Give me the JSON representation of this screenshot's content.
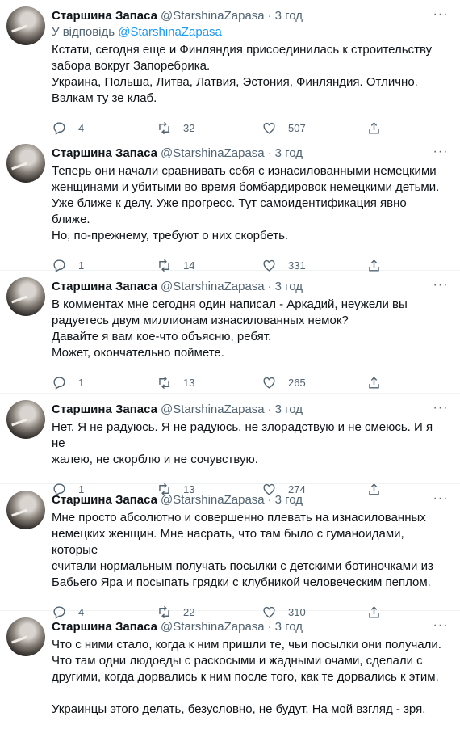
{
  "tweets": [
    {
      "name": "Старшина Запаса",
      "handle": "@StarshinaZapasa",
      "time": "3 год",
      "reply_prefix": "У відповідь",
      "reply_handle": "@StarshinaZapasa",
      "text": "Кстати, сегодня еще и Финляндия присоединилась к строительству\nзабора вокруг Запоребрика.\nУкраина, Польша, Литва, Латвия, Эстония, Финляндия. Отлично.\nВэлкам ту зе клаб.",
      "replies": "4",
      "retweets": "32",
      "likes": "507"
    },
    {
      "name": "Старшина Запаса",
      "handle": "@StarshinaZapasa",
      "time": "3 год",
      "text": "Теперь они начали сравнивать себя с изнасилованными немецкими\nженщинами и убитыми во время бомбардировок немецкими детьми.\nУже ближе к делу. Уже прогресс. Тут самоидентификация явно ближе.\nНо, по-прежнему, требуют о них скорбеть.",
      "replies": "1",
      "retweets": "14",
      "likes": "331"
    },
    {
      "name": "Старшина Запаса",
      "handle": "@StarshinaZapasa",
      "time": "3 год",
      "text": "В комментах мне сегодня один написал - Аркадий, неужели вы\nрадуетесь двум миллионам изнасилованных немок?\nДавайте я вам кое-что объясню, ребят.\nМожет, окончательно поймете.",
      "replies": "1",
      "retweets": "13",
      "likes": "265"
    },
    {
      "name": "Старшина Запаса",
      "handle": "@StarshinaZapasa",
      "time": "3 год",
      "text": "Нет. Я не радуюсь. Я не радуюсь, не злорадствую и не смеюсь. И я не\nжалею, не скорблю и не сочувствую.",
      "replies": "1",
      "retweets": "13",
      "likes": "274"
    },
    {
      "name": "Старшина Запаса",
      "handle": "@StarshinaZapasa",
      "time": "3 год",
      "text": "Мне просто абсолютно и совершенно плевать на изнасилованных\nнемецких женщин. Мне насрать, что там было с гуманоидами, которые\nсчитали нормальным получать посылки с детскими ботиночками из\nБабьего Яра и посыпать грядки с клубникой человеческим пеплом.",
      "replies": "4",
      "retweets": "22",
      "likes": "310"
    },
    {
      "name": "Старшина Запаса",
      "handle": "@StarshinaZapasa",
      "time": "3 год",
      "text": "Что с ними стало, когда к ним пришли те, чьи посылки они получали.\nЧто там одни людоеды с раскосыми и жадными очами, сделали с\nдругими, когда дорвались к ним после того, как те дорвались к этим.\n\nУкраинцы этого делать, безусловно, не будут. На мой взгляд - зря."
    }
  ],
  "more_icon": "more-dots-icon"
}
